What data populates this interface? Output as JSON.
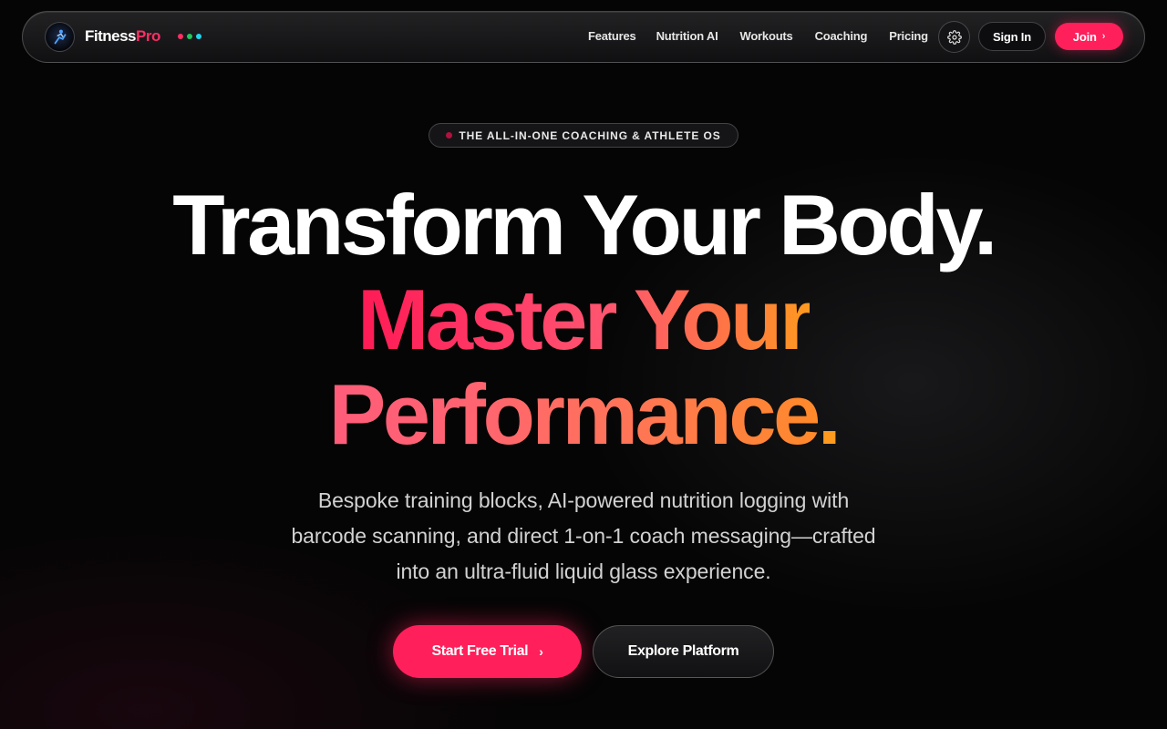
{
  "nav": {
    "brand_part1": "Fitness",
    "brand_part2": "Pro",
    "brand_dots": [
      "#ff2e63",
      "#22c55e",
      "#22d3ee"
    ],
    "links": [
      "Features",
      "Nutrition AI",
      "Workouts",
      "Coaching",
      "Pricing"
    ],
    "settings_icon": "gear-icon",
    "signin_label": "Sign In",
    "join_label": "Join",
    "join_icon": "chevron-right-icon"
  },
  "hero": {
    "badge": "THE ALL-IN-ONE COACHING & ATHLETE OS",
    "headline_line1": "Transform Your Body.",
    "headline_line2": "Master Your",
    "headline_line3": "Performance",
    "headline_line3_period": ".",
    "subtext_line1": "Bespoke training blocks, AI-powered nutrition logging with",
    "subtext_line2": "barcode scanning, and direct 1-on-1 coach messaging—crafted",
    "subtext_line3": "into an ultra-fluid liquid glass experience.",
    "cta_primary": "Start Free Trial",
    "cta_secondary": "Explore Platform"
  },
  "colors": {
    "accent": "#ff1f5a",
    "gradient_end": "#ff9a1f",
    "background": "#050505"
  }
}
